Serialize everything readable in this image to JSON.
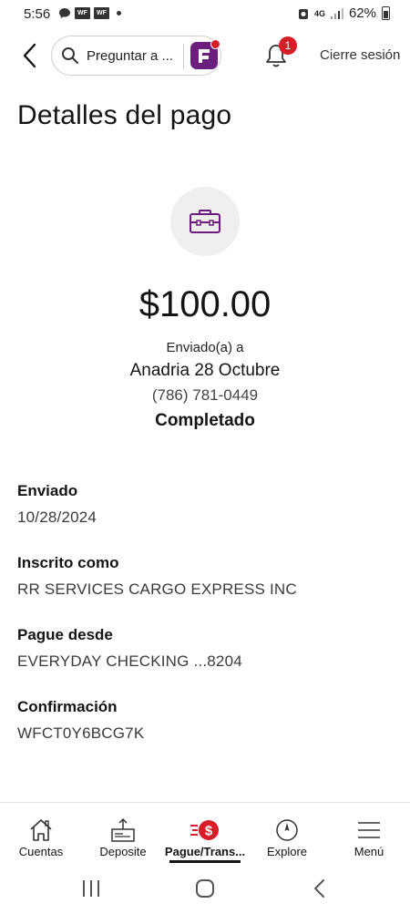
{
  "status_bar": {
    "time": "5:56",
    "notif_badge_1": "WF",
    "notif_badge_2": "WF",
    "network": "4G",
    "battery": "62%"
  },
  "header": {
    "search_placeholder": "Preguntar a ...",
    "notification_count": "1",
    "logout_label": "Cierre sesión"
  },
  "page_title": "Detalles del pago",
  "payment": {
    "amount": "$100.00",
    "sent_to_label": "Enviado(a) a",
    "recipient": "Anadria 28 Octubre",
    "phone": "(786) 781-0449",
    "status": "Completado"
  },
  "details": [
    {
      "label": "Enviado",
      "value": "10/28/2024"
    },
    {
      "label": "Inscrito como",
      "value": "RR SERVICES CARGO EXPRESS INC"
    },
    {
      "label": "Pague desde",
      "value": "EVERYDAY CHECKING ...8204"
    },
    {
      "label": "Confirmación",
      "value": "WFCT0Y6BCG7K"
    }
  ],
  "bottom_nav": [
    {
      "label": "Cuentas",
      "icon": "home-icon"
    },
    {
      "label": "Deposite",
      "icon": "deposit-icon"
    },
    {
      "label": "Pague/Trans...",
      "icon": "pay-transfer-icon",
      "active": true
    },
    {
      "label": "Explore",
      "icon": "compass-icon"
    },
    {
      "label": "Menú",
      "icon": "hamburger-icon"
    }
  ],
  "colors": {
    "brand_red": "#d71e28",
    "brand_purple": "#6b1e7e",
    "icon_circle_bg": "#f1efed"
  }
}
